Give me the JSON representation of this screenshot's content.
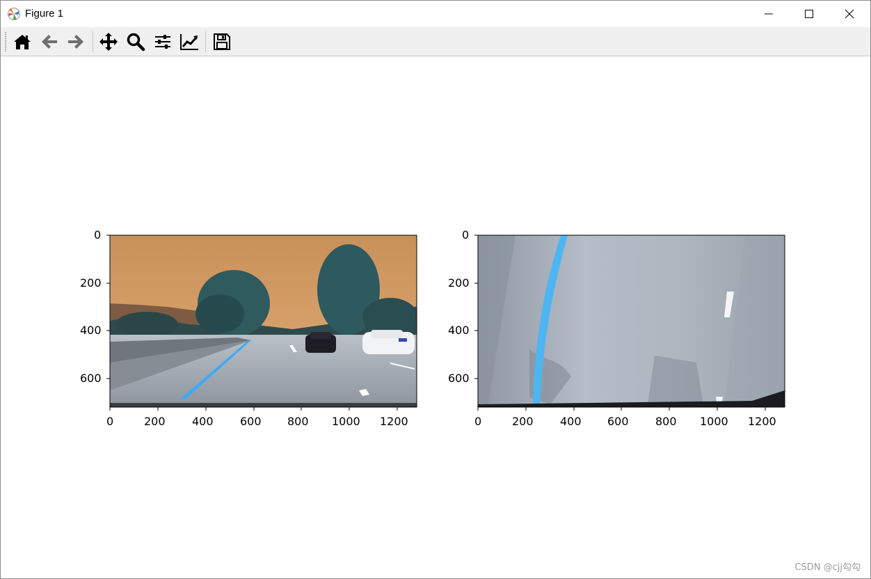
{
  "window": {
    "title": "Figure 1"
  },
  "toolbar": {
    "buttons": [
      {
        "name": "home-icon"
      },
      {
        "name": "back-arrow-icon"
      },
      {
        "name": "forward-arrow-icon"
      },
      {
        "name": "pan-move-icon"
      },
      {
        "name": "zoom-magnifier-icon"
      },
      {
        "name": "configure-subplots-icon"
      },
      {
        "name": "edit-axis-icon"
      },
      {
        "name": "save-floppy-icon"
      }
    ]
  },
  "figure": {
    "axes": [
      {
        "image": "road camera view (color-swapped): orange sky, teal trees, grey road with blue lane line, cars on right",
        "x_ticks": [
          "0",
          "200",
          "400",
          "600",
          "800",
          "1000",
          "1200"
        ],
        "y_ticks": [
          "0",
          "200",
          "400",
          "600"
        ]
      },
      {
        "image": "bird's-eye warped road: grey pavement, curved blue lane line on left, white dashes on right",
        "x_ticks": [
          "0",
          "200",
          "400",
          "600",
          "800",
          "1000",
          "1200"
        ],
        "y_ticks": [
          "0",
          "200",
          "400",
          "600"
        ]
      }
    ]
  },
  "watermark": "CSDN @cjj勾勾"
}
